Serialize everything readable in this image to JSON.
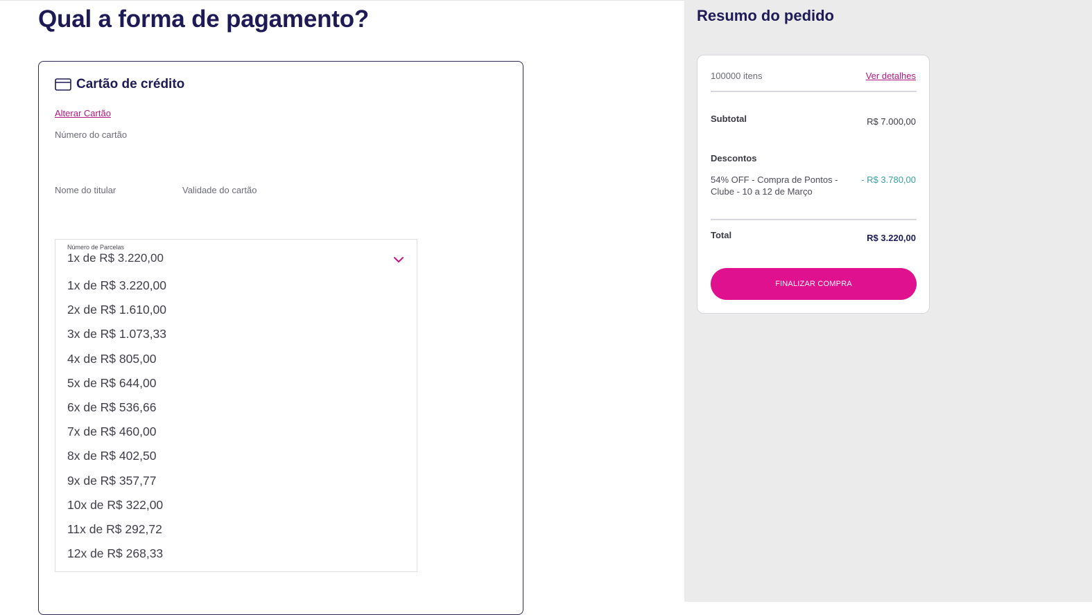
{
  "main": {
    "title": "Qual a forma de pagamento?",
    "payment_card": {
      "heading": "Cartão de crédito",
      "change_link": "Alterar Cartão",
      "card_number_label": "Número do cartão",
      "holder_name_label": "Nome do titular",
      "expiry_label": "Validade do cartão",
      "installments": {
        "label": "Número de Parcelas",
        "selected": "1x de R$ 3.220,00",
        "options": [
          "1x de R$ 3.220,00",
          "2x de R$ 1.610,00",
          "3x de R$ 1.073,33",
          "4x de R$ 805,00",
          "5x de R$ 644,00",
          "6x de R$ 536,66",
          "7x de R$ 460,00",
          "8x de R$ 402,50",
          "9x de R$ 357,77",
          "10x de R$ 322,00",
          "11x de R$ 292,72",
          "12x de R$ 268,33"
        ]
      }
    }
  },
  "sidebar": {
    "title": "Resumo do pedido",
    "items_count": "100000 itens",
    "details_link": "Ver detalhes",
    "subtotal_label": "Subtotal",
    "subtotal_value": "R$ 7.000,00",
    "discounts_label": "Descontos",
    "discount_line1": "54% OFF - Compra de Pontos -",
    "discount_line2": "Clube - 10 a 12 de Março",
    "discount_value": "- R$ 3.780,00",
    "total_label": "Total",
    "total_value": "R$ 3.220,00",
    "finish_button": "FINALIZAR COMPRA"
  },
  "colors": {
    "primary": "#1e1a55",
    "accent": "#e0118f",
    "link": "#b0177f",
    "discount": "#3a9ea0",
    "sidebar_bg": "#ebebeb"
  },
  "icons": {
    "card": "credit-card-icon",
    "dropdown": "chevron-down-icon"
  }
}
